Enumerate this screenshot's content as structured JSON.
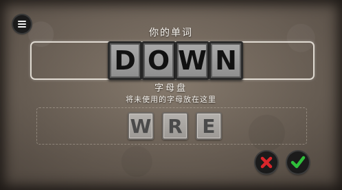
{
  "header": {
    "menu_icon": "hamburger-menu-icon",
    "your_word_label": "你的单词"
  },
  "word": {
    "letters": [
      "D",
      "O",
      "W",
      "N"
    ]
  },
  "bank": {
    "title": "字母盘",
    "instruction": "将未使用的字母放在这里",
    "letters": [
      "W",
      "R",
      "E"
    ]
  },
  "actions": {
    "cancel_icon": "red-x-icon",
    "confirm_icon": "green-check-icon"
  },
  "colors": {
    "cancel_red": "#d8262b",
    "confirm_green": "#2fbf3a"
  }
}
